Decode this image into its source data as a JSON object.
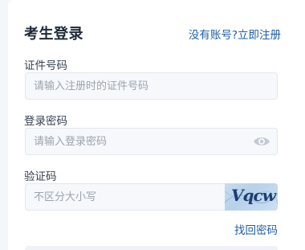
{
  "login": {
    "title": "考生登录",
    "register_link": "没有账号?立即注册",
    "id_label": "证件号码",
    "id_placeholder": "请输入注册时的证件号码",
    "password_label": "登录密码",
    "password_placeholder": "请输入登录密码",
    "captcha_label": "验证码",
    "captcha_placeholder": "不区分大小写",
    "captcha_image_text": "Vqcw",
    "forgot_password": "找回密码"
  },
  "icons": {
    "password_toggle": "eye-icon"
  },
  "colors": {
    "link": "#1e5ea8",
    "input_background": "#f6f8fb",
    "title": "#1f2937"
  }
}
